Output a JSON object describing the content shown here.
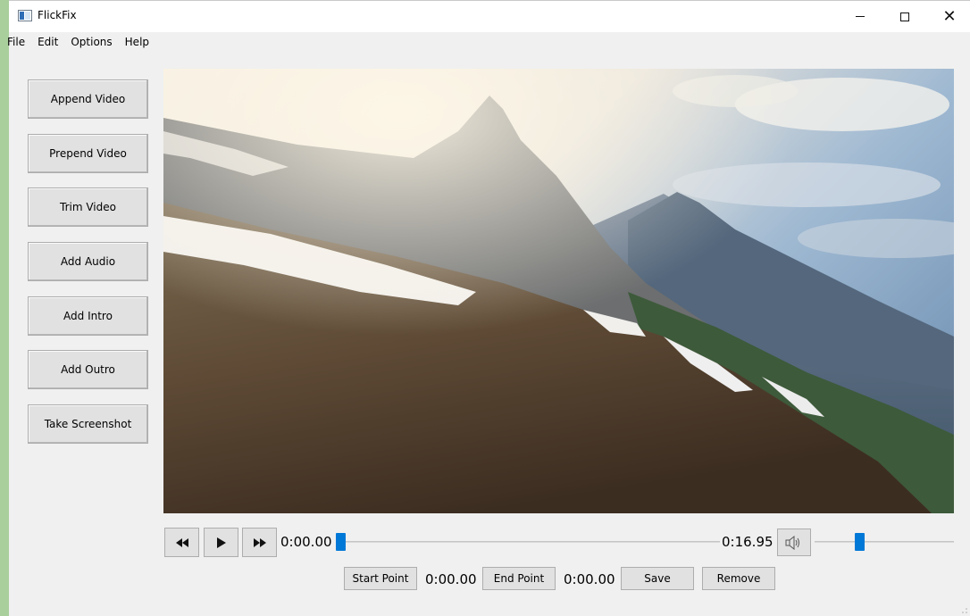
{
  "window": {
    "title": "FlickFix",
    "title_icon": "app-window-icon"
  },
  "menubar": {
    "items": [
      "File",
      "Edit",
      "Options",
      "Help"
    ]
  },
  "sidebar": {
    "buttons": [
      "Append Video",
      "Prepend Video",
      "Trim Video",
      "Add Audio",
      "Add Intro",
      "Add Outro",
      "Take Screenshot"
    ]
  },
  "player": {
    "rewind_icon": "rewind-icon",
    "play_icon": "play-icon",
    "forward_icon": "fast-forward-icon",
    "current_time": "0:00.00",
    "total_time": "0:16.95",
    "seek_progress": 0.0,
    "volume_icon": "speaker-icon",
    "volume_level": 0.31
  },
  "trim": {
    "start_button": "Start Point",
    "start_value": "0:00.00",
    "end_button": "End Point",
    "end_value": "0:00.00",
    "save_button": "Save",
    "remove_button": "Remove"
  },
  "colors": {
    "accent": "#0078d7",
    "button_face": "#e1e1e1",
    "window_bg": "#f0f0f0",
    "desktop": "#a9cf9c"
  }
}
